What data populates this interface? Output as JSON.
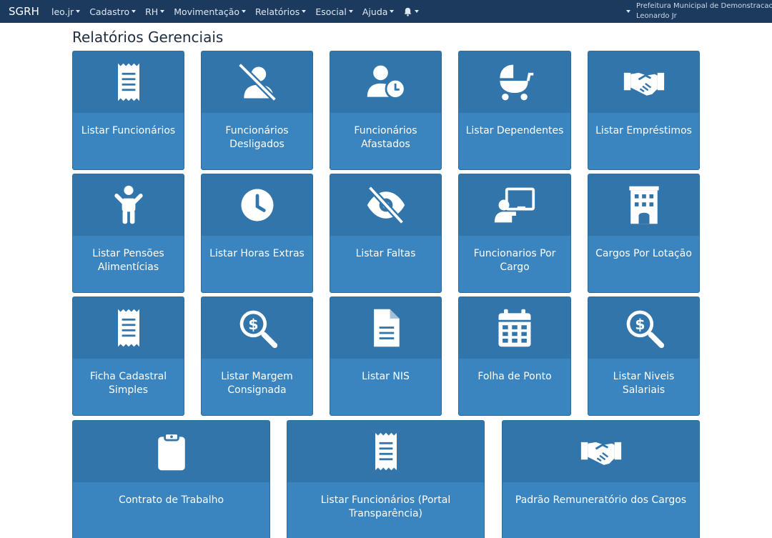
{
  "navbar": {
    "brand": "SGRH",
    "menu": [
      {
        "label": "leo.jr"
      },
      {
        "label": "Cadastro"
      },
      {
        "label": "RH"
      },
      {
        "label": "Movimentação"
      },
      {
        "label": "Relatórios"
      },
      {
        "label": "Esocial"
      },
      {
        "label": "Ajuda"
      }
    ],
    "org_name": "Prefeitura Municipal de Demonstracao",
    "user_name": "Leonardo Jr"
  },
  "page": {
    "title": "Relatórios Gerenciais"
  },
  "tiles": [
    {
      "label": "Listar Funcionários",
      "icon": "receipt-icon"
    },
    {
      "label": "Funcionários Desligados",
      "icon": "user-slash-icon"
    },
    {
      "label": "Funcionários Afastados",
      "icon": "user-clock-icon"
    },
    {
      "label": "Listar Dependentes",
      "icon": "baby-carriage-icon"
    },
    {
      "label": "Listar Empréstimos",
      "icon": "handshake-icon"
    },
    {
      "label": "Listar Pensões Alimentícias",
      "icon": "child-icon"
    },
    {
      "label": "Listar Horas Extras",
      "icon": "clock-icon"
    },
    {
      "label": "Listar Faltas",
      "icon": "eye-slash-icon"
    },
    {
      "label": "Funcionarios Por Cargo",
      "icon": "chalkboard-teacher-icon"
    },
    {
      "label": "Cargos Por Lotação",
      "icon": "building-icon"
    },
    {
      "label": "Ficha Cadastral Simples",
      "icon": "receipt-icon"
    },
    {
      "label": "Listar Margem Consignada",
      "icon": "search-dollar-icon"
    },
    {
      "label": "Listar NIS",
      "icon": "file-alt-icon"
    },
    {
      "label": "Folha de Ponto",
      "icon": "calendar-icon"
    },
    {
      "label": "Listar Niveis Salariais",
      "icon": "search-dollar-icon"
    },
    {
      "label": "Contrato de Trabalho",
      "icon": "clipboard-icon"
    },
    {
      "label": "Listar Funcionários (Portal Transparência)",
      "icon": "receipt-icon"
    },
    {
      "label": "Padrão Remuneratório dos Cargos",
      "icon": "handshake-icon"
    }
  ]
}
